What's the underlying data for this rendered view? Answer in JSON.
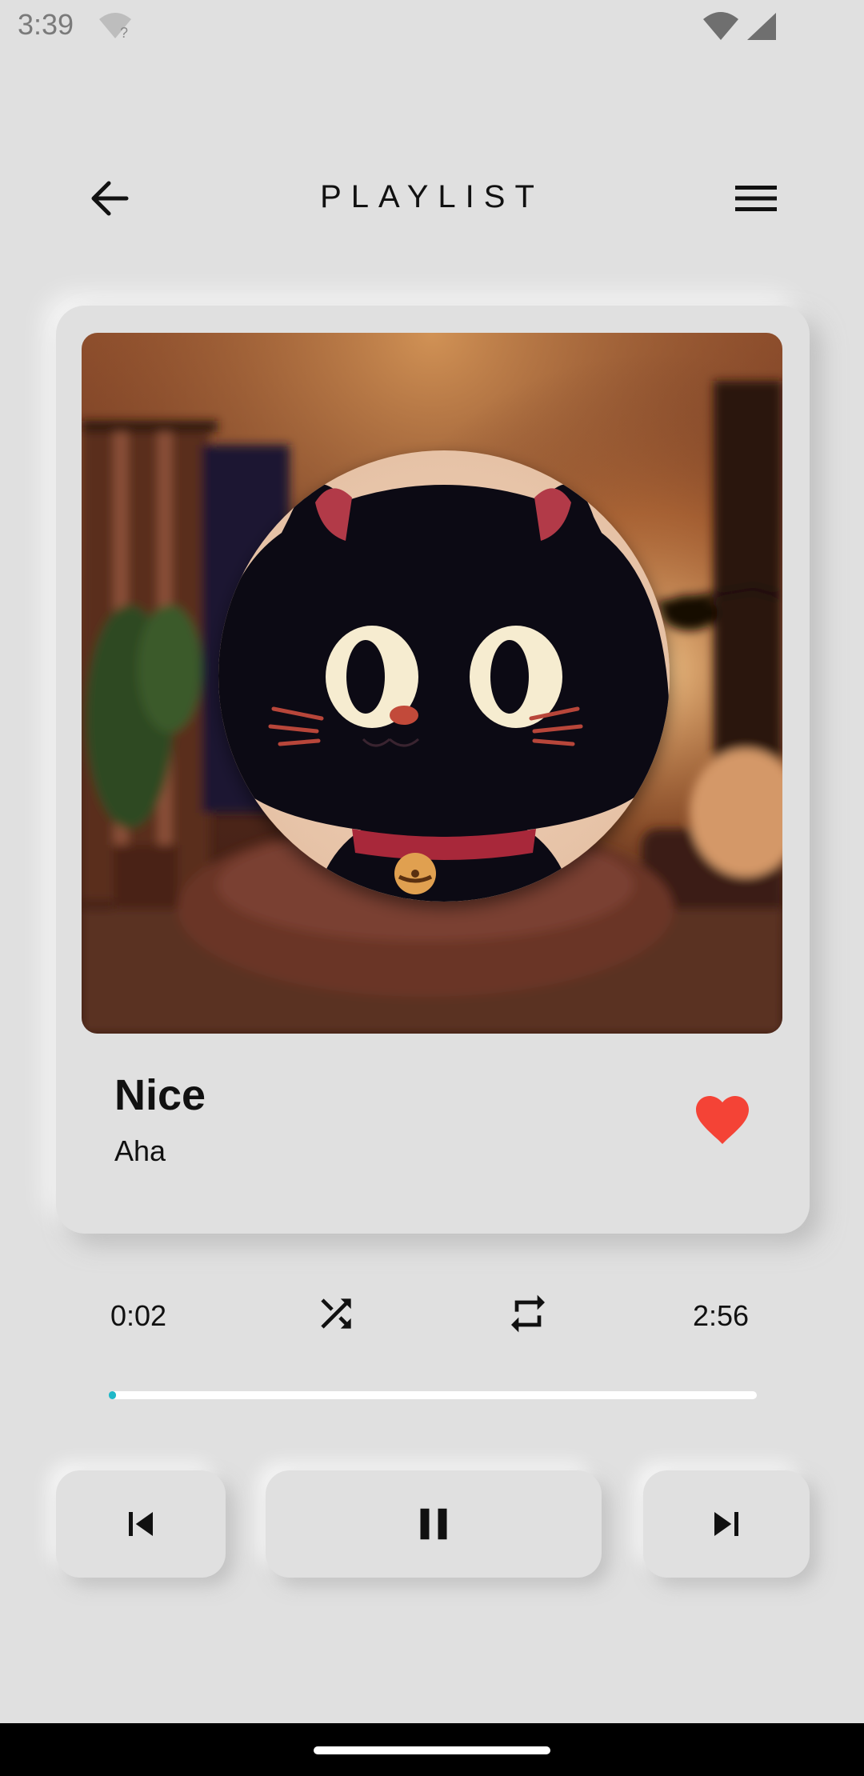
{
  "status_bar": {
    "time": "3:39",
    "icons": [
      "wifi-unknown-icon",
      "wifi-icon",
      "signal-icon"
    ]
  },
  "header": {
    "title": "PLAYLIST",
    "back_icon": "arrow-left-icon",
    "menu_icon": "hamburger-menu-icon"
  },
  "now_playing": {
    "title": "Nice",
    "artist": "Aha",
    "liked": true,
    "heart_color": "#f44336",
    "artwork": "black-cat-avatar-in-cozy-room"
  },
  "player": {
    "current_time": "0:02",
    "total_time": "2:56",
    "progress_fraction": 0.011,
    "progress_color": "#20b8c8",
    "shuffle_icon": "shuffle-icon",
    "repeat_icon": "repeat-icon"
  },
  "controls": {
    "previous_icon": "skip-previous-icon",
    "pause_icon": "pause-icon",
    "next_icon": "skip-next-icon"
  },
  "colors": {
    "background": "#e0e0e0"
  }
}
